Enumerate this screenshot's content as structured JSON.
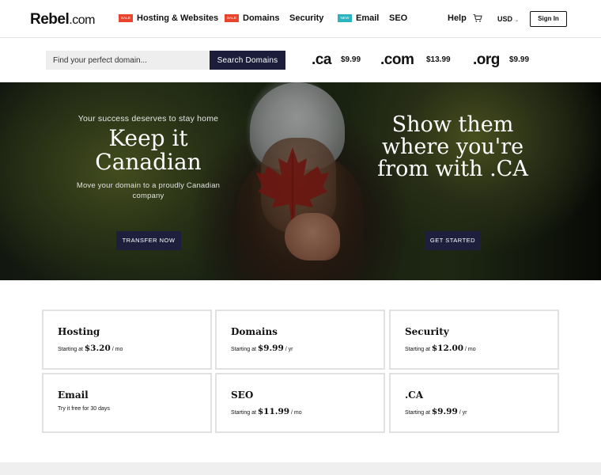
{
  "header": {
    "logo_bold": "Rebel",
    "logo_rest": ".com",
    "nav": [
      {
        "label": "Hosting & Websites",
        "tag": "SALE",
        "tag_color": "#e8452c"
      },
      {
        "label": "Domains",
        "tag": "SALE",
        "tag_color": "#e8452c"
      },
      {
        "label": "Security",
        "tag": null
      },
      {
        "label": "Email",
        "tag": "NEW",
        "tag_color": "#2bb3c0"
      },
      {
        "label": "SEO",
        "tag": null
      }
    ],
    "help": "Help",
    "cart_icon": "shopping-cart-icon",
    "currency": "USD",
    "sign_in": "Sign In"
  },
  "search": {
    "placeholder": "Find your perfect domain...",
    "button": "Search Domains",
    "tlds": [
      {
        "name": ".ca",
        "price": "$9.99"
      },
      {
        "name": ".com",
        "price": "$13.99"
      },
      {
        "name": ".org",
        "price": "$9.99"
      }
    ]
  },
  "hero": {
    "left": {
      "subtitle": "Your success deserves to stay home",
      "title_line1": "Keep it",
      "title_line2": "Canadian",
      "description": "Move your domain to a proudly Canadian company",
      "button": "TRANSFER NOW"
    },
    "right": {
      "title_line1": "Show them",
      "title_line2": "where you're",
      "title_line3": "from with .CA",
      "button": "GET STARTED"
    },
    "button_color": "#1d1f3c"
  },
  "products": [
    {
      "title": "Hosting",
      "prefix": "Starting at",
      "price": "$3.20",
      "unit": "/ mo"
    },
    {
      "title": "Domains",
      "prefix": "Starting at",
      "price": "$9.99",
      "unit": "/ yr"
    },
    {
      "title": "Security",
      "prefix": "Starting at",
      "price": "$12.00",
      "unit": "/ mo"
    },
    {
      "title": "Email",
      "prefix": "Try it free for 30 days",
      "price": "",
      "unit": ""
    },
    {
      "title": "SEO",
      "prefix": "Starting at",
      "price": "$11.99",
      "unit": "/ mo"
    },
    {
      "title": ".CA",
      "prefix": "Starting at",
      "price": "$9.99",
      "unit": "/ yr"
    }
  ]
}
